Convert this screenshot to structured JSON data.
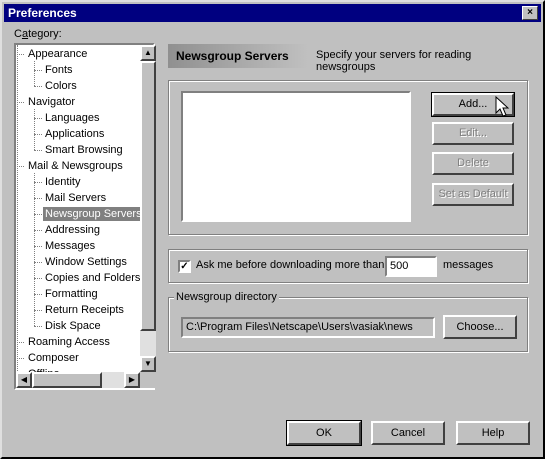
{
  "window": {
    "title": "Preferences",
    "close_label": "×"
  },
  "category": {
    "label_pre": "C",
    "label_u": "a",
    "label_post": "tegory:"
  },
  "tree": [
    {
      "label": "Appearance",
      "level": 0,
      "expander": "-"
    },
    {
      "label": "Fonts",
      "level": 1
    },
    {
      "label": "Colors",
      "level": 1
    },
    {
      "label": "Navigator",
      "level": 0,
      "expander": "-"
    },
    {
      "label": "Languages",
      "level": 1
    },
    {
      "label": "Applications",
      "level": 1
    },
    {
      "label": "Smart Browsing",
      "level": 1
    },
    {
      "label": "Mail & Newsgroups",
      "level": 0,
      "expander": "-"
    },
    {
      "label": "Identity",
      "level": 1
    },
    {
      "label": "Mail Servers",
      "level": 1
    },
    {
      "label": "Newsgroup Servers",
      "level": 1,
      "selected": true
    },
    {
      "label": "Addressing",
      "level": 1
    },
    {
      "label": "Messages",
      "level": 1
    },
    {
      "label": "Window Settings",
      "level": 1
    },
    {
      "label": "Copies and Folders",
      "level": 1
    },
    {
      "label": "Formatting",
      "level": 1
    },
    {
      "label": "Return Receipts",
      "level": 1
    },
    {
      "label": "Disk Space",
      "level": 1
    },
    {
      "label": "Roaming Access",
      "level": 0,
      "expander": "+"
    },
    {
      "label": "Composer",
      "level": 0,
      "expander": "+"
    },
    {
      "label": "Offline",
      "level": 0,
      "expander": "+"
    }
  ],
  "panel": {
    "title": "Newsgroup Servers",
    "description": "Specify your servers for reading newsgroups"
  },
  "buttons": {
    "add": "Add...",
    "edit": "Edit...",
    "delete": "Delete",
    "set_default": "Set as Default"
  },
  "ask": {
    "checked": true,
    "check_mark": "✓",
    "label": "Ask me before downloading more than",
    "value": "500",
    "suffix": "messages"
  },
  "directory": {
    "group_label": "Newsgroup directory",
    "path": "C:\\Program Files\\Netscape\\Users\\vasiak\\news",
    "choose": "Choose..."
  },
  "footer": {
    "ok": "OK",
    "cancel": "Cancel",
    "help": "Help"
  }
}
